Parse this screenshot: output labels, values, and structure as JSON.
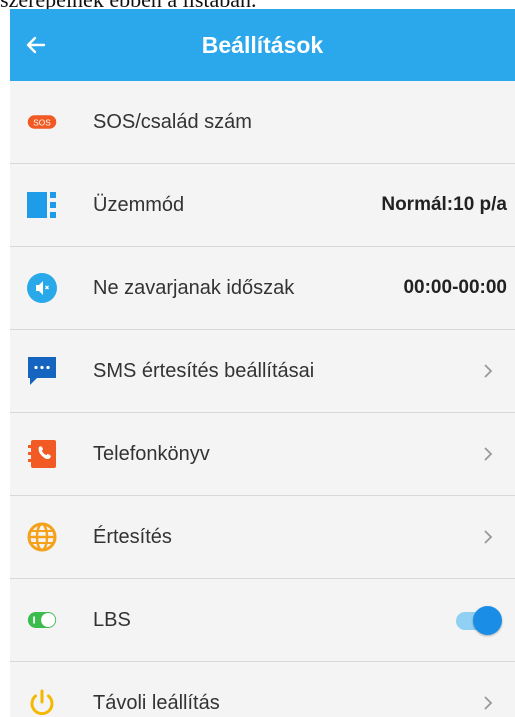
{
  "caption": "szerepelnek ebben a listában.",
  "header": {
    "title": "Beállítások",
    "background_color": "#2ba7ec"
  },
  "sos_badge_text": "SOS",
  "settings": [
    {
      "icon": "sos-badge-icon",
      "label": "SOS/család szám"
    },
    {
      "icon": "mode-icon",
      "label": "Üzemmód",
      "value": "Normál:10 p/a"
    },
    {
      "icon": "mute-speaker-icon",
      "label": "Ne zavarjanak időszak",
      "value": "00:00-00:00"
    },
    {
      "icon": "sms-bubble-icon",
      "label": "SMS értesítés beállításai",
      "chevron": true
    },
    {
      "icon": "phonebook-icon",
      "label": "Telefonkönyv",
      "chevron": true
    },
    {
      "icon": "globe-icon",
      "label": "Értesítés",
      "chevron": true
    },
    {
      "icon": "lbs-toggle-icon",
      "label": "LBS",
      "toggle_on": true
    },
    {
      "icon": "power-icon",
      "label": "Távoli leállítás",
      "chevron": true
    }
  ]
}
